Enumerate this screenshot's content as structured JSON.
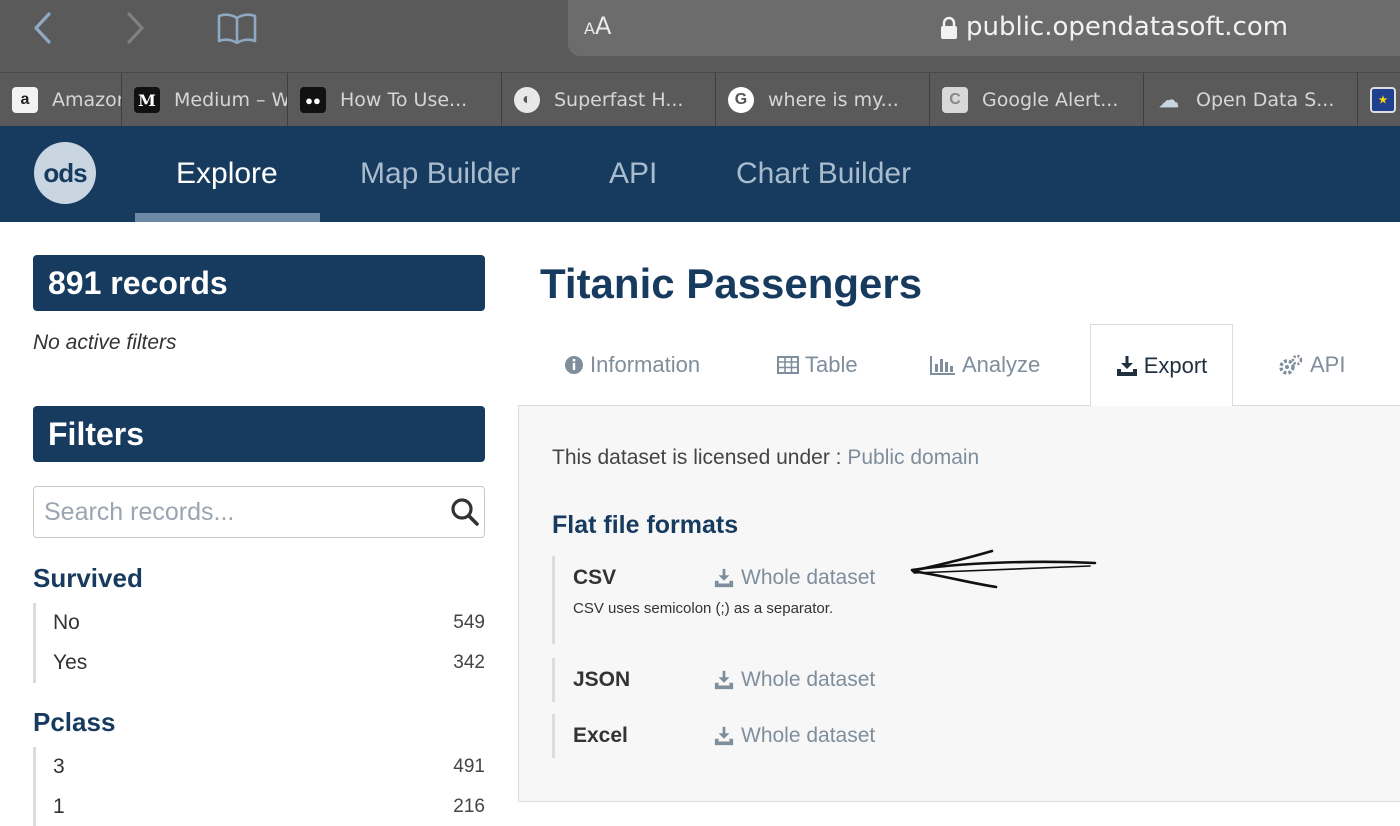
{
  "browser": {
    "url_aa": "AA",
    "url": "public.opendatasoft.com",
    "bookmarks": [
      {
        "label": "Amazon",
        "icon": "amazon-icon"
      },
      {
        "label": "Medium – W",
        "icon": "medium-icon"
      },
      {
        "label": "How To Use...",
        "icon": "medium-dots-icon"
      },
      {
        "label": "Superfast H...",
        "icon": "superfast-icon"
      },
      {
        "label": "where is my...",
        "icon": "google-icon"
      },
      {
        "label": "Google Alert...",
        "icon": "google-alerts-icon"
      },
      {
        "label": "Open Data S...",
        "icon": "cloud-icon"
      }
    ]
  },
  "header": {
    "logo": "ods",
    "tabs": [
      "Explore",
      "Map Builder",
      "API",
      "Chart Builder"
    ],
    "active_tab": "Explore"
  },
  "sidebar": {
    "records": "891 records",
    "no_filters": "No active filters",
    "filters_title": "Filters",
    "search_placeholder": "Search records...",
    "facets": [
      {
        "title": "Survived",
        "items": [
          {
            "label": "No",
            "count": "549"
          },
          {
            "label": "Yes",
            "count": "342"
          }
        ]
      },
      {
        "title": "Pclass",
        "items": [
          {
            "label": "3",
            "count": "491"
          },
          {
            "label": "1",
            "count": "216"
          }
        ]
      }
    ]
  },
  "main": {
    "title": "Titanic Passengers",
    "tabs": [
      "Information",
      "Table",
      "Analyze",
      "Export",
      "API"
    ],
    "active_tab": "Export",
    "license_prefix": "This dataset is licensed under : ",
    "license_link": "Public domain",
    "flat_title": "Flat file formats",
    "formats": [
      {
        "name": "CSV",
        "link": "Whole dataset",
        "note": "CSV uses semicolon (;) as a separator."
      },
      {
        "name": "JSON",
        "link": "Whole dataset"
      },
      {
        "name": "Excel",
        "link": "Whole dataset"
      }
    ]
  },
  "colors": {
    "brand_navy": "#173b5e",
    "muted_link": "#7f8e9c"
  }
}
